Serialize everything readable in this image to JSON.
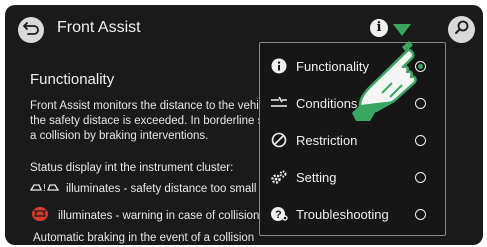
{
  "header": {
    "title": "Front Assist",
    "back_icon": "back-arrow-icon",
    "info_icon_glyph": "i",
    "search_icon": "search-icon",
    "accent": "#3aa660"
  },
  "content": {
    "heading": "Functionality",
    "paragraph_lines": [
      "Front Assist monitors the distance to the vehicle ahead, it warns the driver when",
      "the safety distace is exceeded. In borderline situations it tries to avoid",
      "a collision by braking interventions."
    ],
    "status_text": "Status display int the instrument cluster:",
    "row1_text": "illuminates - safety distance too small",
    "row2_text": "illuminates - warning in case of collision",
    "automatic_braking": "Automatic braking in the event of a collision"
  },
  "menu": {
    "items": [
      {
        "label": "Functionality",
        "icon": "info-icon",
        "selected": true
      },
      {
        "label": "Conditions",
        "icon": "conditions-icon",
        "selected": false
      },
      {
        "label": "Restriction",
        "icon": "restriction-icon",
        "selected": false
      },
      {
        "label": "Setting",
        "icon": "gears-icon",
        "selected": false
      },
      {
        "label": "Troubleshooting",
        "icon": "help-icon",
        "selected": false
      }
    ]
  }
}
